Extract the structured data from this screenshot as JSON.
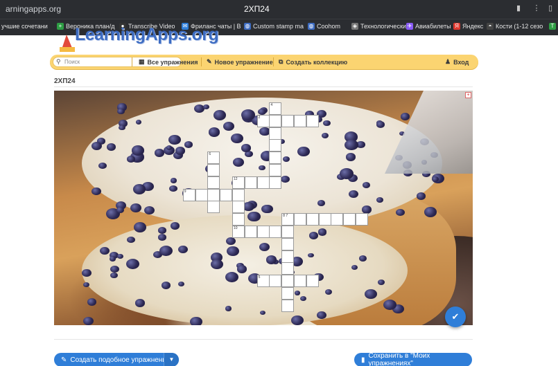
{
  "browser": {
    "url": "arningapps.org",
    "tab_title": "2ХП24",
    "bookmarks": [
      {
        "label": "учшие сочетани",
        "icon": "bookmark-icon",
        "color": "#2b2d31"
      },
      {
        "label": "Вероника план/д",
        "icon": "plus-icon",
        "color": "#2e9e44"
      },
      {
        "label": "Transcribe Video",
        "icon": "record-icon",
        "color": "#333333"
      },
      {
        "label": "Фриланс чаты | В",
        "icon": "chat-icon",
        "color": "#2f7ed8"
      },
      {
        "label": "Custom stamp ma",
        "icon": "globe-icon",
        "color": "#3d6cc2"
      },
      {
        "label": "Coohom",
        "icon": "globe-icon",
        "color": "#3d6cc2"
      },
      {
        "label": "Технологические",
        "icon": "tech-icon",
        "color": "#777777"
      },
      {
        "label": "Авиабилеты",
        "icon": "plane-icon",
        "color": "#8a5cf6"
      },
      {
        "label": "Яндекс",
        "icon": "yandex-icon",
        "color": "#e0382e"
      },
      {
        "label": "Кости (1-12 сезо",
        "icon": "mask-icon",
        "color": "#444444"
      },
      {
        "label": "Ti",
        "icon": "ti-icon",
        "color": "#2e9e44"
      }
    ]
  },
  "site": {
    "logo": "LearningApps.org",
    "accent": "#fbd471",
    "nav": {
      "search_placeholder": "Поиск",
      "all_exercises": "Все упражнения",
      "new_exercise": "Новое упражнение",
      "create_collection": "Создать коллекцию",
      "login": "Вход"
    },
    "page_title": "2ХП24"
  },
  "crossword": {
    "cells": [
      {
        "col": 8,
        "row": 0,
        "num": "4"
      },
      {
        "col": 7,
        "row": 1,
        "num": "2"
      },
      {
        "col": 8,
        "row": 1,
        "num": ""
      },
      {
        "col": 9,
        "row": 1,
        "num": ""
      },
      {
        "col": 10,
        "row": 1,
        "num": ""
      },
      {
        "col": 11,
        "row": 1,
        "num": ""
      },
      {
        "col": 8,
        "row": 2,
        "num": ""
      },
      {
        "col": 8,
        "row": 3,
        "num": ""
      },
      {
        "col": 8,
        "row": 4,
        "num": ""
      },
      {
        "col": 3,
        "row": 4,
        "num": "6"
      },
      {
        "col": 8,
        "row": 5,
        "num": ""
      },
      {
        "col": 3,
        "row": 5,
        "num": ""
      },
      {
        "col": 5,
        "row": 6,
        "num": "12"
      },
      {
        "col": 6,
        "row": 6,
        "num": ""
      },
      {
        "col": 7,
        "row": 6,
        "num": ""
      },
      {
        "col": 8,
        "row": 6,
        "num": ""
      },
      {
        "col": 3,
        "row": 6,
        "num": ""
      },
      {
        "col": 5,
        "row": 7,
        "num": ""
      },
      {
        "col": 1,
        "row": 7,
        "num": "9"
      },
      {
        "col": 2,
        "row": 7,
        "num": ""
      },
      {
        "col": 3,
        "row": 7,
        "num": ""
      },
      {
        "col": 4,
        "row": 7,
        "num": ""
      },
      {
        "col": 3,
        "row": 8,
        "num": ""
      },
      {
        "col": 5,
        "row": 8,
        "num": ""
      },
      {
        "col": 5,
        "row": 9,
        "num": ""
      },
      {
        "col": 9,
        "row": 9,
        "num": "8 7"
      },
      {
        "col": 10,
        "row": 9,
        "num": ""
      },
      {
        "col": 11,
        "row": 9,
        "num": ""
      },
      {
        "col": 12,
        "row": 9,
        "num": ""
      },
      {
        "col": 13,
        "row": 9,
        "num": ""
      },
      {
        "col": 14,
        "row": 9,
        "num": ""
      },
      {
        "col": 15,
        "row": 9,
        "num": ""
      },
      {
        "col": 5,
        "row": 10,
        "num": "10"
      },
      {
        "col": 6,
        "row": 10,
        "num": ""
      },
      {
        "col": 7,
        "row": 10,
        "num": ""
      },
      {
        "col": 8,
        "row": 10,
        "num": ""
      },
      {
        "col": 9,
        "row": 10,
        "num": ""
      },
      {
        "col": 9,
        "row": 11,
        "num": ""
      },
      {
        "col": 9,
        "row": 12,
        "num": ""
      },
      {
        "col": 9,
        "row": 13,
        "num": ""
      },
      {
        "col": 7,
        "row": 14,
        "num": "5"
      },
      {
        "col": 8,
        "row": 14,
        "num": ""
      },
      {
        "col": 9,
        "row": 14,
        "num": ""
      },
      {
        "col": 10,
        "row": 14,
        "num": ""
      },
      {
        "col": 11,
        "row": 14,
        "num": ""
      },
      {
        "col": 9,
        "row": 15,
        "num": ""
      },
      {
        "col": 9,
        "row": 16,
        "num": ""
      }
    ]
  },
  "actions": {
    "create_similar": "Создать подобное упражнение",
    "save_to_my": "Сохранить в \"Моих упражнениях\""
  }
}
